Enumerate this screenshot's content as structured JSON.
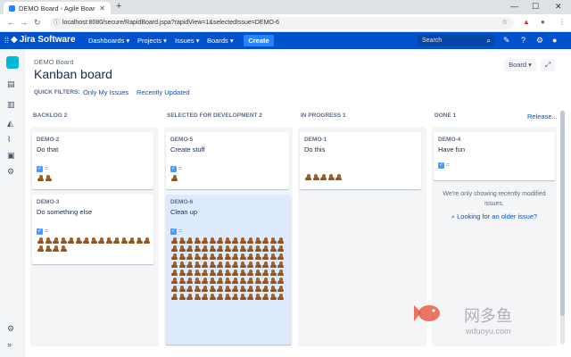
{
  "browser": {
    "tab_title": "DEMO Board - Agile Board",
    "url": "localhost:8080/secure/RapidBoard.jspa?rapidView=1&selectedIssue=DEMO-6"
  },
  "jira_nav": {
    "logo": "Jira Software",
    "menus": [
      "Dashboards ▾",
      "Projects ▾",
      "Issues ▾",
      "Boards ▾"
    ],
    "create": "Create",
    "search_placeholder": "Search"
  },
  "header": {
    "breadcrumb": "DEMO Board",
    "title": "Kanban board",
    "board_button": "Board ▾",
    "quick_filters_label": "QUICK FILTERS:",
    "quick_filters": [
      "Only My Issues",
      "Recently Updated"
    ]
  },
  "columns": [
    {
      "name": "BACKLOG",
      "count": "2"
    },
    {
      "name": "SELECTED FOR DEVELOPMENT",
      "count": "2"
    },
    {
      "name": "IN PROGRESS",
      "count": "1"
    },
    {
      "name": "DONE",
      "count": "1"
    }
  ],
  "release_link": "Release...",
  "cards": [
    {
      "key": "DEMO-2",
      "summary": "Do that",
      "poops": 2
    },
    {
      "key": "DEMO-3",
      "summary": "Do something else",
      "poops": 19
    },
    {
      "key": "DEMO-5",
      "summary": "Create stuff",
      "poops": 1
    },
    {
      "key": "DEMO-6",
      "summary": "Clean up",
      "poops": 120
    },
    {
      "key": "DEMO-1",
      "summary": "Do this",
      "poops": 5
    },
    {
      "key": "DEMO-4",
      "summary": "Have fun",
      "poops": 0
    }
  ],
  "done_note": "We're only showing recently modified issues.",
  "older_link": "Looking for an older issue?",
  "watermark": {
    "text": "网多鱼",
    "sub": "wduoyu.com"
  },
  "colors": {
    "jira_blue": "#0052cc",
    "create_blue": "#2684ff",
    "selected_card": "#deebff"
  }
}
